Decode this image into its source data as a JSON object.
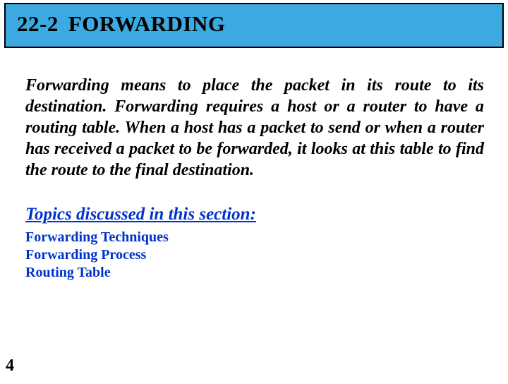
{
  "title": {
    "section_number": "22-2",
    "heading": "FORWARDING"
  },
  "body": "Forwarding means to place the packet in its route to its destination. Forwarding requires a host or a router to have a routing table. When a host has a packet to send or when a router has received a packet to be forwarded, it looks at this table to find the route to the final destination.",
  "topics_heading": "Topics discussed in this section:",
  "topics": [
    "Forwarding Techniques",
    "Forwarding Process",
    "Routing Table"
  ],
  "page_number": "4"
}
